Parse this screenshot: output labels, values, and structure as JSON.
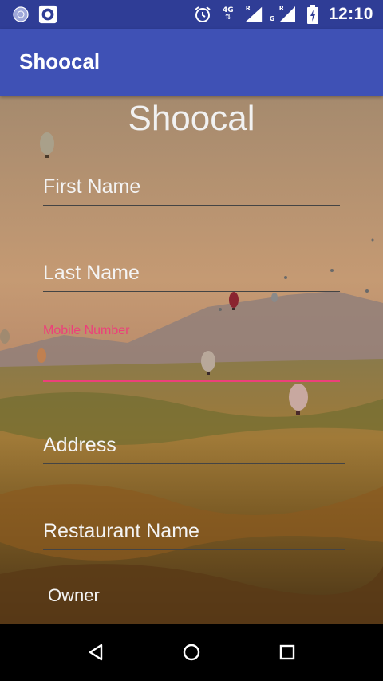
{
  "status_bar": {
    "time": "12:10",
    "network_label": "4G",
    "sim1_label": "R",
    "sim2_label": "R",
    "sim2_sub": "G",
    "icons": [
      "sync-icon",
      "record-icon",
      "alarm-icon",
      "data-arrows-icon",
      "signal-icon",
      "battery-charging-icon"
    ]
  },
  "app_bar": {
    "title": "Shoocal"
  },
  "form": {
    "heading": "Shoocal",
    "fields": {
      "first_name": "First Name",
      "last_name": "Last Name",
      "mobile_number": "Mobile Number",
      "address": "Address",
      "restaurant_name": "Restaurant Name"
    },
    "owner_label": "Owner"
  },
  "nav_bar": {
    "icons": [
      "back-icon",
      "home-icon",
      "recents-icon"
    ]
  },
  "colors": {
    "status_bar": "#2f3d96",
    "app_bar": "#3f51b5",
    "accent": "#ec407a"
  }
}
